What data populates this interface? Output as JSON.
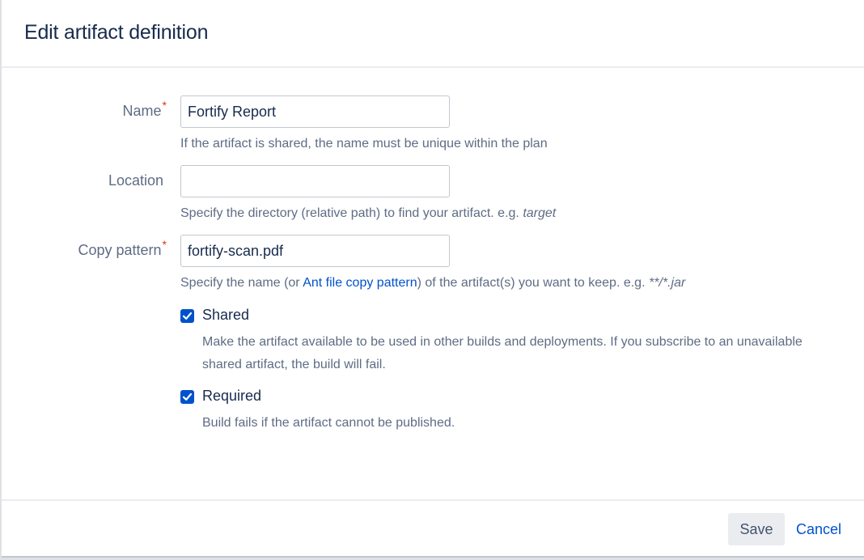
{
  "dialog": {
    "title": "Edit artifact definition"
  },
  "form": {
    "name": {
      "label": "Name",
      "required_mark": "*",
      "value": "Fortify Report",
      "help": "If the artifact is shared, the name must be unique within the plan"
    },
    "location": {
      "label": "Location",
      "value": "",
      "help_prefix": "Specify the directory (relative path) to find your artifact. e.g. ",
      "help_example": "target"
    },
    "copy_pattern": {
      "label": "Copy pattern",
      "required_mark": "*",
      "value": "fortify-scan.pdf",
      "help_prefix": "Specify the name (or ",
      "help_link": "Ant file copy pattern",
      "help_middle": ") of the artifact(s) you want to keep. e.g. ",
      "help_example": "**/*.jar"
    },
    "shared": {
      "label": "Shared",
      "checked": true,
      "desc_line1": "Make the artifact available to be used in other builds and deployments. If you subscribe to an unavailable",
      "desc_line2": "shared artifact, the build will fail."
    },
    "required": {
      "label": "Required",
      "checked": true,
      "desc": "Build fails if the artifact cannot be published."
    }
  },
  "footer": {
    "save_label": "Save",
    "cancel_label": "Cancel"
  },
  "colors": {
    "accent": "#0052cc",
    "required": "#de350b",
    "text": "#172b4d",
    "muted": "#5e6c84"
  },
  "icons": {
    "checkbox": "check-icon"
  }
}
